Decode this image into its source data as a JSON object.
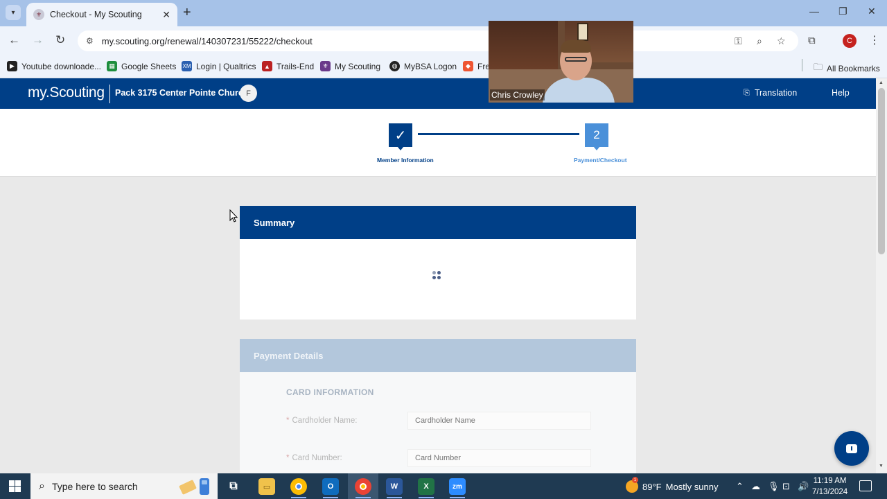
{
  "browser": {
    "tab_title": "Checkout - My Scouting",
    "url": "my.scouting.org/renewal/140307231/55222/checkout",
    "bookmarks": [
      {
        "label": "Youtube downloade..."
      },
      {
        "label": "Google Sheets"
      },
      {
        "label": "Login | Qualtrics"
      },
      {
        "label": "Trails-End"
      },
      {
        "label": "My Scouting"
      },
      {
        "label": "MyBSA Logon"
      },
      {
        "label": "Fre"
      }
    ],
    "all_bookmarks": "All Bookmarks",
    "profile_initial": "C"
  },
  "site": {
    "logo": "my.Scouting",
    "unit_name": "Pack 3175 Center Pointe Church",
    "unit_badge": "F",
    "translation": "Translation",
    "help": "Help"
  },
  "stepper": {
    "step1_label": "Member Information",
    "step2_number": "2",
    "step2_label": "Payment/Checkout"
  },
  "summary": {
    "title": "Summary"
  },
  "payment": {
    "title": "Payment Details",
    "card_info": "CARD INFORMATION",
    "cardholder_label": "Cardholder Name:",
    "cardholder_placeholder": "Cardholder Name",
    "card_number_label": "Card Number:",
    "card_number_placeholder": "Card Number"
  },
  "video": {
    "participant_name": "Chris Crowley"
  },
  "taskbar": {
    "search_placeholder": "Type here to search",
    "weather_temp": "89°F",
    "weather_desc": "Mostly sunny",
    "time": "11:19 AM",
    "date": "7/13/2024"
  },
  "colors": {
    "brand_blue": "#003f87",
    "step_active": "#4a90d9",
    "payment_header": "#b3c7dc"
  }
}
